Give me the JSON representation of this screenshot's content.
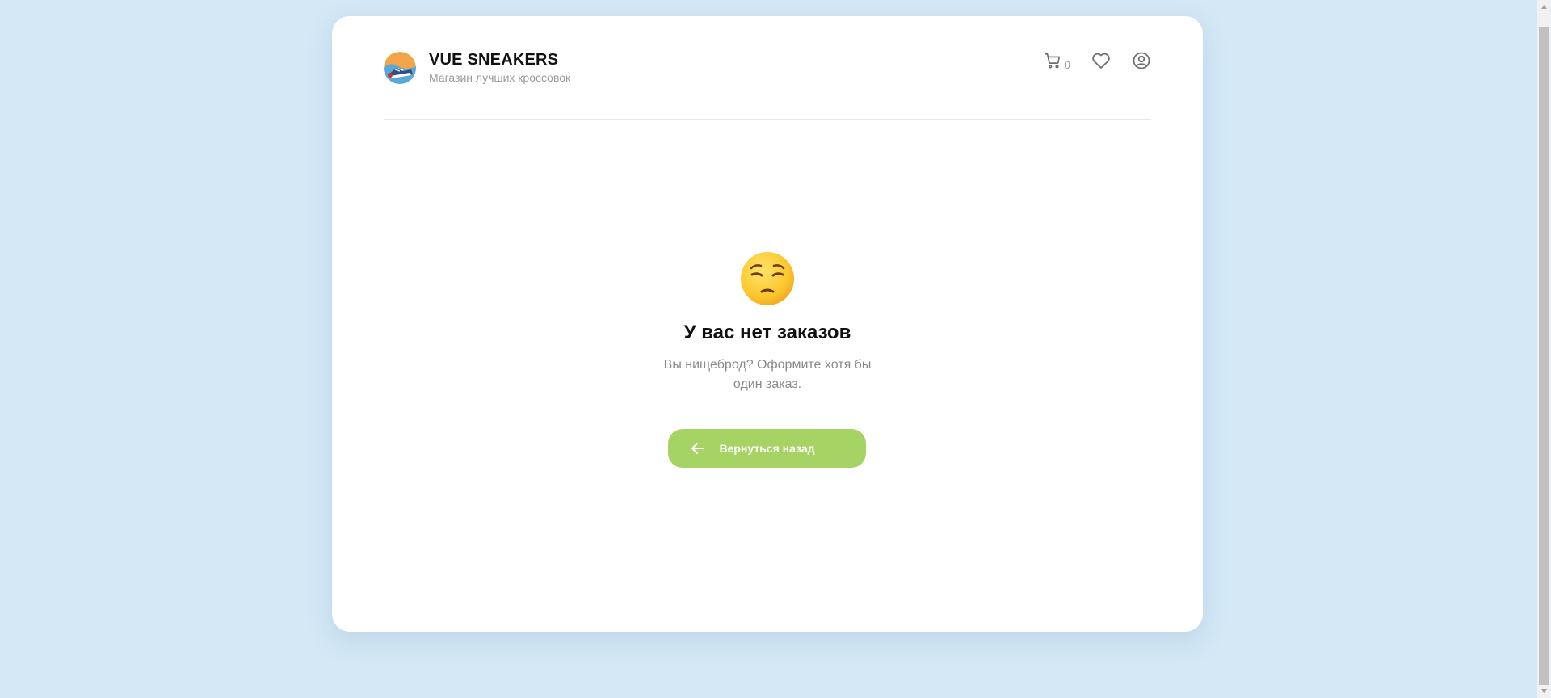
{
  "header": {
    "title": "VUE SNEAKERS",
    "subtitle": "Магазин лучших кроссовок",
    "cart_count": "0",
    "icons": [
      "logo-image",
      "cart-icon",
      "heart-icon",
      "user-icon"
    ]
  },
  "empty_state": {
    "emoji": "pensive-face",
    "title": "У вас нет заказов",
    "text": "Вы нищеброд? Оформите хотя бы один заказ."
  },
  "back_button": {
    "label": "Вернуться назад",
    "icon": "arrow-left-icon"
  },
  "colors": {
    "page_background": "#d4e8f6",
    "card_background": "#ffffff",
    "accent": "#a5d364",
    "muted_text": "#9b9b9b"
  }
}
